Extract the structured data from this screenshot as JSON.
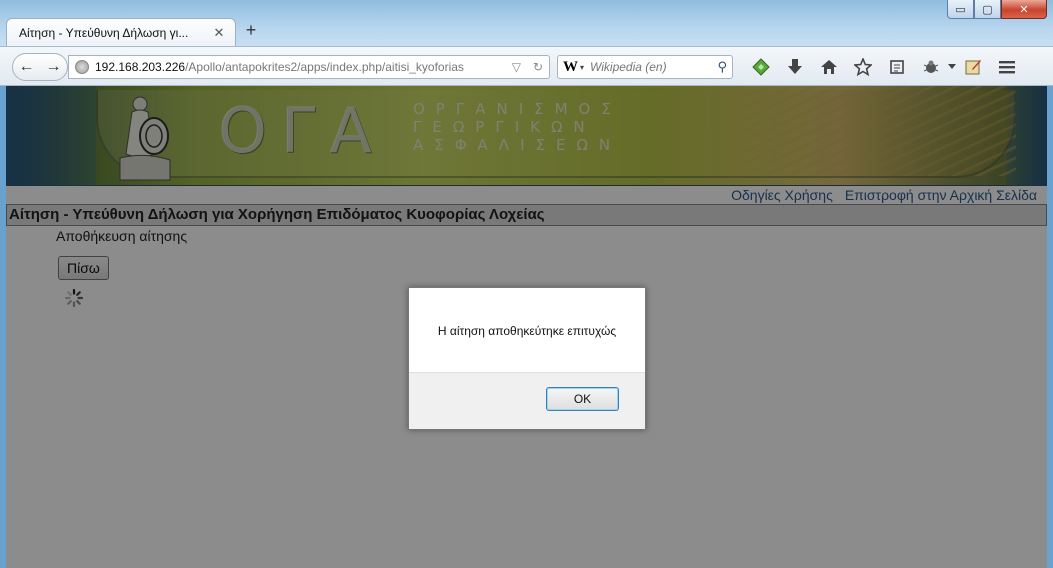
{
  "window": {
    "tab_title": "Αίτηση - Υπεύθυνη Δήλωση γι...",
    "tab_close": "✕",
    "new_tab": "+",
    "controls": {
      "minimize": "▭",
      "maximize": "▢",
      "close": "✕"
    }
  },
  "navbar": {
    "back": "←",
    "forward": "→",
    "url_host": "192.168.203.226",
    "url_path": "/Apollo/antapokrites2/apps/index.php/aitisi_kyoforias",
    "url_dropdown": "▽",
    "reload": "↻",
    "search_engine": "W",
    "search_engine_caret": "▾",
    "search_placeholder": "Wikipedia (en)",
    "search_icon": "⚲",
    "icons": [
      "download-icon",
      "home-icon",
      "bookmark-star-icon",
      "reading-list-icon",
      "addon-icon",
      "menu-icon"
    ]
  },
  "banner": {
    "logo": "ΟΓΑ",
    "subtitle_lines": [
      "ΟΡΓΑΝΙΣΜΟΣ",
      "ΓΕΩΡΓΙΚΩΝ",
      "ΑΣΦΑΛΙΣΕΩΝ"
    ]
  },
  "topmenu": {
    "help": "Οδηγίες Χρήσης",
    "home": "Επιστροφή στην Αρχική Σελίδα"
  },
  "page": {
    "heading": "Αίτηση - Υπεύθυνη Δήλωση για Χορήγηση Επιδόματος Κυοφορίας Λοχείας",
    "status": "Αποθήκευση αίτησης",
    "back_button": "Πίσω"
  },
  "dialog": {
    "message": "Η αίτηση αποθηκεύτηκε επιτυχώς",
    "ok_button": "OK"
  },
  "colors": {
    "link": "#2a5b8f",
    "overlay": "rgba(0,0,0,0.45)",
    "dialog_focus": "#3c7fb1"
  }
}
